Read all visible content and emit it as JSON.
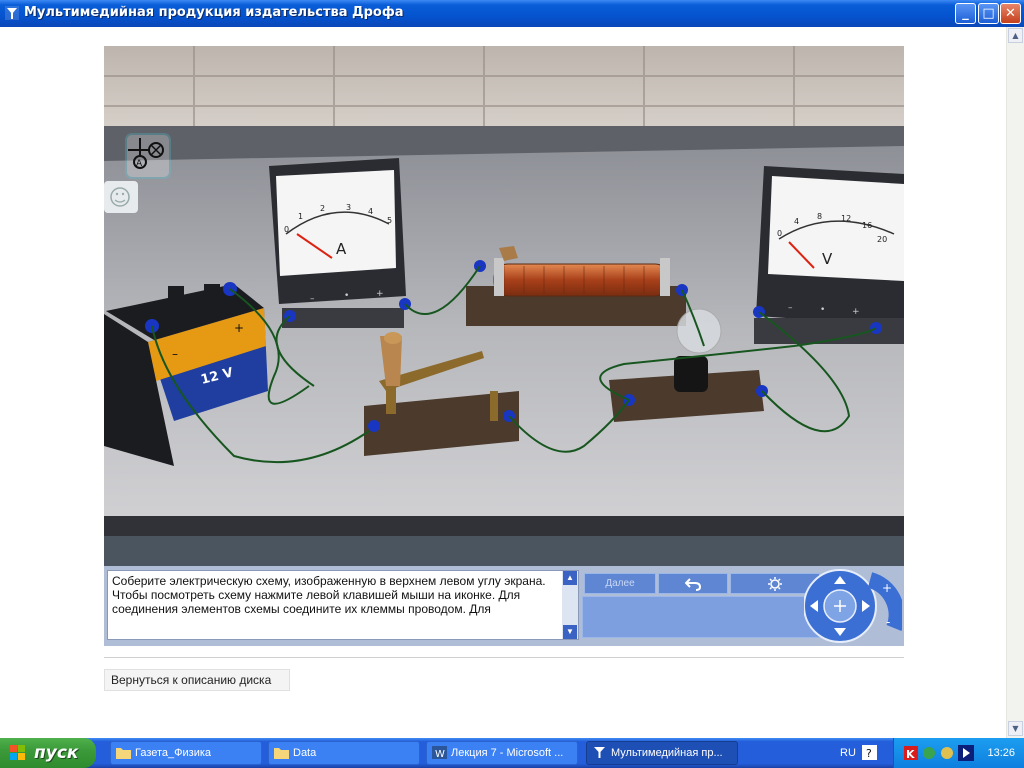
{
  "window": {
    "title": "Мультимедийная продукция издательства Дрофа",
    "buttons": {
      "minimize": "_",
      "maximize": "□",
      "close": "✕"
    }
  },
  "scene": {
    "ammeter": {
      "scale": [
        "0",
        "1",
        "2",
        "3",
        "4",
        "5"
      ],
      "symbol": "A",
      "signs": [
        "–",
        "•",
        "+"
      ]
    },
    "voltmeter": {
      "scale": [
        "0",
        "4",
        "8",
        "12",
        "16",
        "20"
      ],
      "symbol": "V",
      "signs": [
        "–",
        "•",
        "+"
      ]
    },
    "battery_label": "12 V",
    "battery_signs": [
      "–",
      "+"
    ],
    "schematic_icon": "circuit-schematic-icon",
    "smile_icon": "smile-icon"
  },
  "instructions": {
    "text": "Соберите электрическую схему, изображенную в верхнем левом углу экрана. Чтобы посмотреть схему нажмите левой клавишей мыши на иконке. Для соединения элементов схемы соедините их клеммы проводом. Для"
  },
  "controls": {
    "next_label": "Далее",
    "undo_icon": "undo-icon",
    "settings_icon": "gear-icon",
    "zoom_in": "+",
    "zoom_out": "-"
  },
  "back_link": "Вернуться к описанию диска",
  "taskbar": {
    "start_label": "пуск",
    "tasks": [
      {
        "label": "Газета_Физика",
        "icon": "folder-icon"
      },
      {
        "label": "Data",
        "icon": "folder-icon"
      },
      {
        "label": "Лекция 7 - Microsoft ...",
        "icon": "word-icon"
      },
      {
        "label": "Мультимедийная пр...",
        "icon": "app-icon"
      }
    ],
    "language": "RU",
    "clock": "13:26"
  },
  "colors": {
    "titlebar": "#0553cf",
    "panel": "#b0bdd6",
    "accent": "#3b63c4",
    "taskbar": "#245edb",
    "start": "#3c9a3a"
  }
}
